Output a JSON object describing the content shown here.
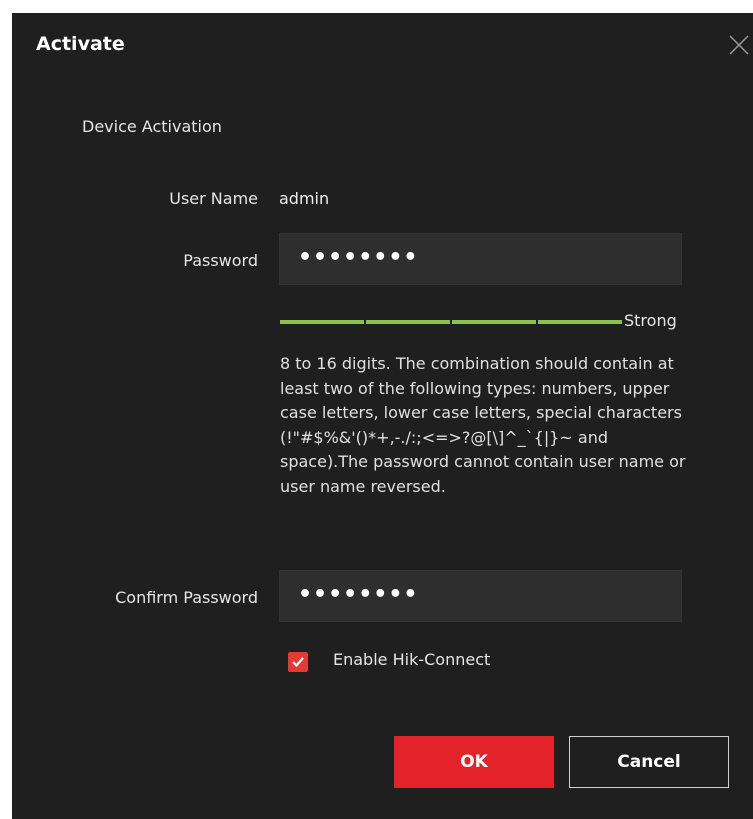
{
  "dialog": {
    "title": "Activate",
    "close_icon": "close-icon"
  },
  "section": {
    "title": "Device Activation"
  },
  "user_name": {
    "label": "User Name",
    "value": "admin"
  },
  "password": {
    "label": "Password",
    "value": "••••••••"
  },
  "strength": {
    "label": "Strong",
    "color": "#8bc34a",
    "segments_filled": 4,
    "segments_total": 4
  },
  "hint": {
    "text": "8 to 16 digits. The combination should contain at least two of the following types: numbers, upper case letters, lower case letters, special characters (!\"#$%&'()*+,-./:;<=>?@[\\]^_`{|}~ and space).The password cannot contain user name or user name reversed."
  },
  "confirm_password": {
    "label": "Confirm Password",
    "value": "••••••••"
  },
  "hik_connect": {
    "label": "Enable Hik-Connect",
    "checked": true,
    "check_color": "#e53935"
  },
  "buttons": {
    "ok": "OK",
    "cancel": "Cancel",
    "ok_color": "#e32329"
  }
}
